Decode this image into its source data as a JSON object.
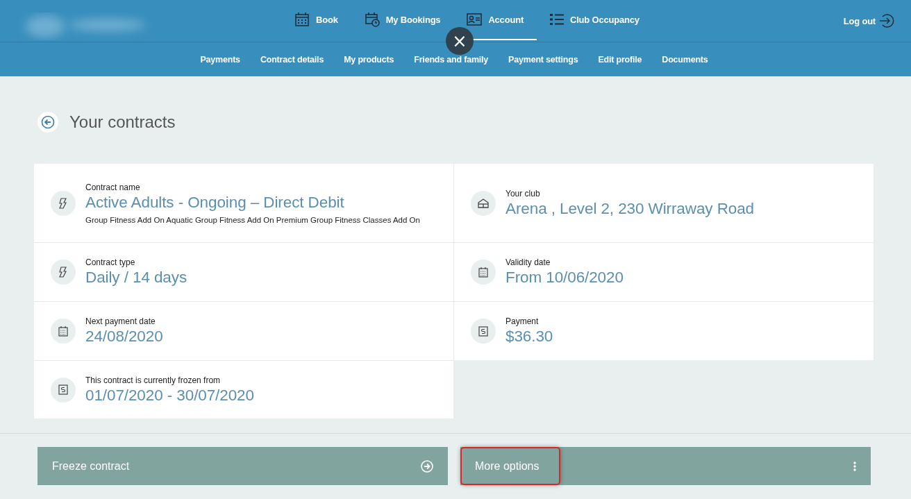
{
  "nav": {
    "items": [
      {
        "label": "Book",
        "kind": "calendar",
        "selected": false
      },
      {
        "label": "My Bookings",
        "kind": "bookings",
        "selected": false
      },
      {
        "label": "Account",
        "kind": "account",
        "selected": true
      },
      {
        "label": "Club Occupancy",
        "kind": "list",
        "selected": false
      }
    ],
    "logout": "Log out"
  },
  "subnav": [
    "Payments",
    "Contract details",
    "My products",
    "Friends and family",
    "Payment settings",
    "Edit profile",
    "Documents"
  ],
  "overlay_close": "×",
  "page": {
    "title": "Your contracts"
  },
  "details": [
    {
      "kind": "contract",
      "label": "Contract name",
      "value": "Active Adults - Ongoing – Direct Debit",
      "note": "Group Fitness Add On Aquatic Group Fitness Add On Premium Group Fitness Classes Add On"
    },
    {
      "kind": "club",
      "label": "Your club",
      "value": "Arena , Level 2, 230 Wirraway Road"
    },
    {
      "kind": "contract",
      "label": "Contract type",
      "value": "Daily / 14 days"
    },
    {
      "kind": "date",
      "label": "Validity date",
      "value": "From 10/06/2020"
    },
    {
      "kind": "date",
      "label": "Next payment date",
      "value": "24/08/2020"
    },
    {
      "kind": "payment",
      "label": "Payment",
      "value": "$36.30"
    },
    {
      "kind": "payment",
      "label": "This contract is currently frozen from",
      "value": "01/07/2020 - 30/07/2020"
    }
  ],
  "actions": [
    {
      "label": "Freeze contract",
      "kind": "arrow",
      "highlighted": false
    },
    {
      "label": "More options",
      "kind": "menu",
      "highlighted": true
    }
  ]
}
